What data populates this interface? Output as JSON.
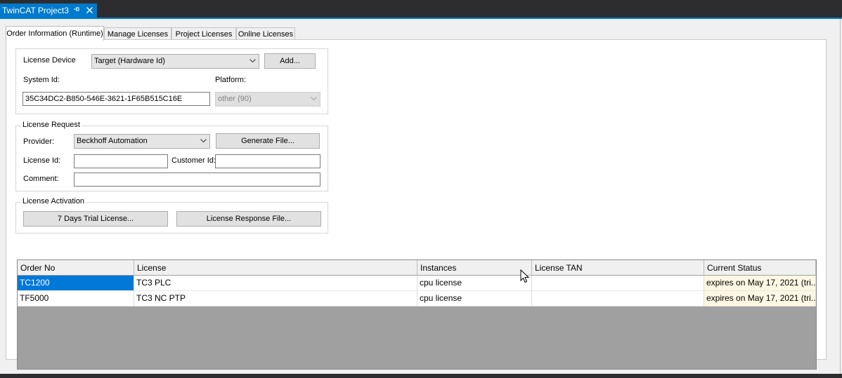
{
  "document_tab": {
    "title": "TwinCAT Project3",
    "pin_icon": "pin-icon",
    "close_icon": "close-icon"
  },
  "tabs": [
    {
      "label": "Order Information (Runtime)",
      "active": true
    },
    {
      "label": "Manage Licenses",
      "active": false
    },
    {
      "label": "Project Licenses",
      "active": false
    },
    {
      "label": "Online Licenses",
      "active": false
    }
  ],
  "device": {
    "license_device_label": "License Device",
    "license_device_value": "Target (Hardware Id)",
    "add_button": "Add...",
    "system_id_label": "System Id:",
    "system_id_value": "35C34DC2-B850-546E-3621-1F65B515C16E",
    "platform_label": "Platform:",
    "platform_value": "other (90)"
  },
  "license_request": {
    "title": "License Request",
    "provider_label": "Provider:",
    "provider_value": "Beckhoff Automation",
    "generate_button": "Generate File...",
    "license_id_label": "License Id:",
    "license_id_value": "",
    "customer_id_label": "Customer Id:",
    "customer_id_value": "",
    "comment_label": "Comment:",
    "comment_value": ""
  },
  "license_activation": {
    "title": "License Activation",
    "trial_button": "7 Days Trial License...",
    "response_button": "License Response File..."
  },
  "grid": {
    "columns": [
      "Order No",
      "License",
      "Instances",
      "License TAN",
      "Current Status"
    ],
    "rows": [
      {
        "order_no": "TC1200",
        "license": "TC3 PLC",
        "instances": "cpu license",
        "license_tan": "",
        "status": "expires on May 17, 2021 (tri..."
      },
      {
        "order_no": "TF5000",
        "license": "TC3 NC PTP",
        "instances": "cpu license",
        "license_tan": "",
        "status": "expires on May 17, 2021 (tri..."
      }
    ]
  },
  "colors": {
    "accent": "#007acc",
    "selection": "#0078d7",
    "status_cell": "#fff7e3",
    "grid_background": "#a0a0a0"
  }
}
